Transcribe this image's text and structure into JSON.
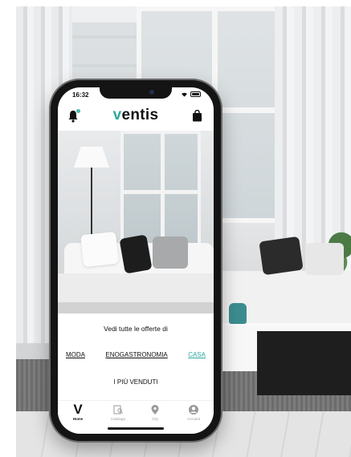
{
  "status_bar": {
    "time": "16:32"
  },
  "header": {
    "logo_text": "entis",
    "logo_letter": "v"
  },
  "offers": {
    "title": "Vedi tutte le offerte di",
    "categories": [
      {
        "label": "MODA",
        "active": false
      },
      {
        "label": "ENOGASTRONOMIA",
        "active": false
      },
      {
        "label": "CASA",
        "active": true
      }
    ],
    "bestsellers": "I PIÙ VENDUTI"
  },
  "tabbar": {
    "tabs": [
      {
        "label": "Home",
        "icon": "ventis-v-icon",
        "active": true
      },
      {
        "label": "Cataloga",
        "icon": "catalog-search-icon",
        "active": false
      },
      {
        "label": "City",
        "icon": "location-pin-icon",
        "active": false
      },
      {
        "label": "Account",
        "icon": "user-icon",
        "active": false
      }
    ]
  },
  "colors": {
    "accent": "#2fa89b",
    "text": "#111111",
    "tab_inactive": "#9a9a9a"
  }
}
